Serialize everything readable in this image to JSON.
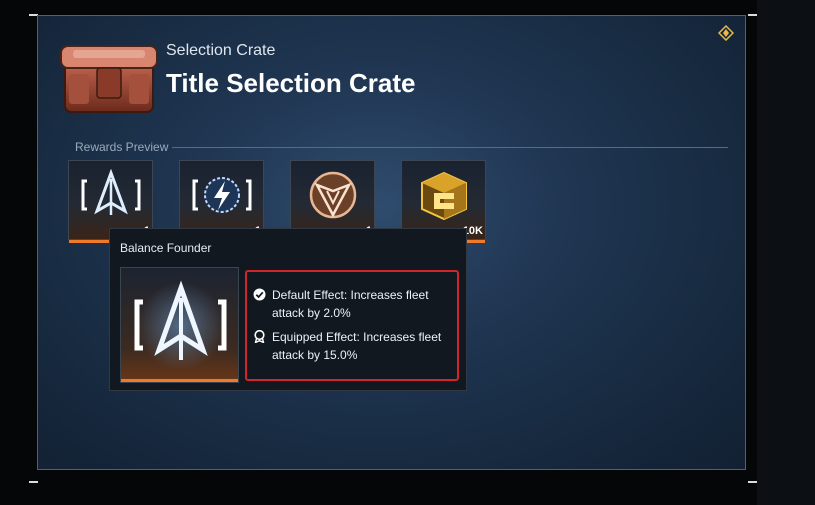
{
  "header": {
    "subtitle": "Selection Crate",
    "title": "Title Selection Crate"
  },
  "rewards_preview": {
    "label": "Rewards Preview",
    "items": [
      {
        "icon": "arrow-emblem-icon",
        "quantity": "1"
      },
      {
        "icon": "lightning-emblem-icon",
        "quantity": "1"
      },
      {
        "icon": "shield-emblem-icon",
        "quantity": "1"
      },
      {
        "icon": "gold-cube-icon",
        "quantity": "10K"
      }
    ]
  },
  "tooltip": {
    "title": "Balance Founder",
    "icon": "arrow-emblem-icon",
    "default_effect": "Default Effect: Increases fleet attack by  2.0%",
    "equipped_effect": "Equipped Effect: Increases fleet attack by  15.0%"
  },
  "colors": {
    "accent_orange": "#f07a2a",
    "highlight_red": "#d2242a",
    "info_gold": "#e8b84a"
  }
}
